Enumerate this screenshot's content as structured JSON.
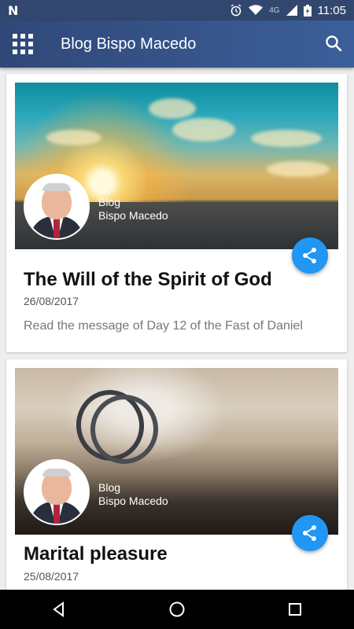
{
  "status_bar": {
    "time": "11:05",
    "network": "4G",
    "icons": [
      "notification-n-icon",
      "alarm-icon",
      "wifi-icon",
      "cell-signal-icon",
      "battery-icon"
    ]
  },
  "app_bar": {
    "title": "Blog Bispo Macedo",
    "menu_icon": "grid-menu-icon",
    "search_icon": "search-icon"
  },
  "posts": [
    {
      "author_line1": "Blog",
      "author_line2": "Bispo Macedo",
      "title": "The Will of the Spirit of God",
      "date": "26/08/2017",
      "description": "Read the message of Day 12 of the Fast of Daniel"
    },
    {
      "author_line1": "Blog",
      "author_line2": "Bispo Macedo",
      "title": "Marital pleasure",
      "date": "25/08/2017"
    }
  ],
  "colors": {
    "app_bar": "#3b5f9a",
    "status_bar": "#32476f",
    "fab": "#2196f3"
  }
}
